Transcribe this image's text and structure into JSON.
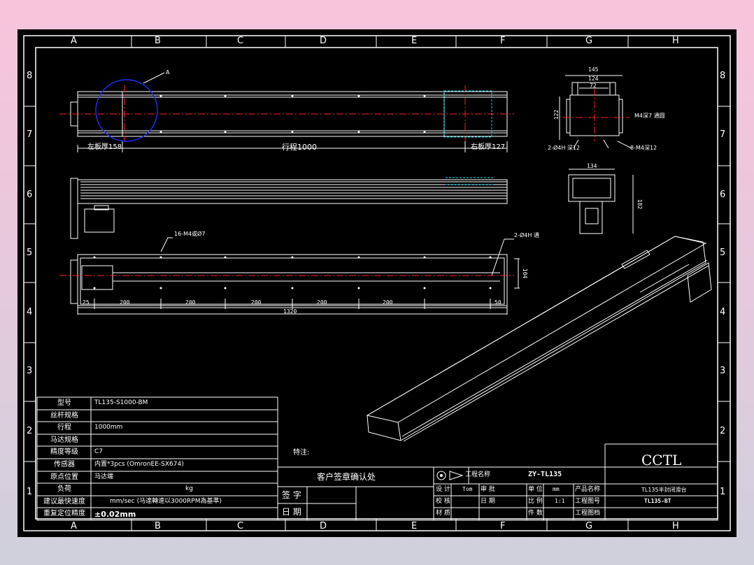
{
  "zones": {
    "columns": [
      "A",
      "B",
      "C",
      "D",
      "E",
      "F",
      "G",
      "H"
    ],
    "rows": [
      "8",
      "7",
      "6",
      "5",
      "4",
      "3",
      "2",
      "1"
    ]
  },
  "views": {
    "detail_callout": "A",
    "top_left_dim": "左板厚158",
    "top_stroke_dim": "行程1000",
    "top_right_dim": "右板厚127",
    "end_width_total": "145",
    "end_width_mid": "124",
    "end_width_inner": "72",
    "end_height": "122",
    "end_note_right": "M4深7 通圆",
    "end_hole_left": "2-Ø4H 深12",
    "end_hole_right": "8-M4深12",
    "section_width": "134",
    "section_height": "182",
    "bottom_holes_note": "16-M4或Ø7",
    "bottom_thru_note": "2-Ø4H 通",
    "bottom_height": "104",
    "bottom_dims": [
      "25",
      "200",
      "200",
      "200",
      "200",
      "200",
      "50"
    ],
    "bottom_total": "1320"
  },
  "spec_table": {
    "rows": [
      {
        "label": "型号",
        "value": "TL135-S1000-BM"
      },
      {
        "label": "丝杆规格",
        "value": ""
      },
      {
        "label": "行程",
        "value": "1000mm"
      },
      {
        "label": "马达规格",
        "value": ""
      },
      {
        "label": "精度等级",
        "value": "C7"
      },
      {
        "label": "传感器",
        "value": "内置*3pcs (OmronEE-SX674)"
      },
      {
        "label": "原点位置",
        "value": "马达端"
      },
      {
        "label": "负荷",
        "value": "kg"
      },
      {
        "label": "建议最快速度",
        "value": "mm/sec (马達轉速以3000RPM為基準)"
      },
      {
        "label": "重复定位精度",
        "value": "±0.02mm"
      }
    ]
  },
  "special_note": "特注:",
  "customer_box": {
    "title": "客户签章确认处",
    "sign_label": "签 字",
    "date_label": "日 期"
  },
  "title_block": {
    "project_label": "工程名称",
    "project_value": "ZY-TL135",
    "row1": {
      "design": "设 计",
      "design_val": "Tom",
      "approve": "审 批",
      "unit": "单 位",
      "unit_val": "mm",
      "product_label": "产品名称",
      "product_val": "TL135半封闭滑台"
    },
    "row2": {
      "check": "校 核",
      "date": "日 期",
      "scale": "比 例",
      "scale_val": "1:1",
      "drawing_no_label": "工程图号",
      "drawing_no_val": "TL135-BT"
    },
    "row3": {
      "material": "材 质",
      "pieces": "件 数",
      "archive_label": "工程图档"
    },
    "company": "CCTL"
  },
  "colors": {
    "line": "#ffffff",
    "center": "#ff2020",
    "hidden": "#00e5ff",
    "detail": "#2030ff",
    "paper": "#000000"
  }
}
